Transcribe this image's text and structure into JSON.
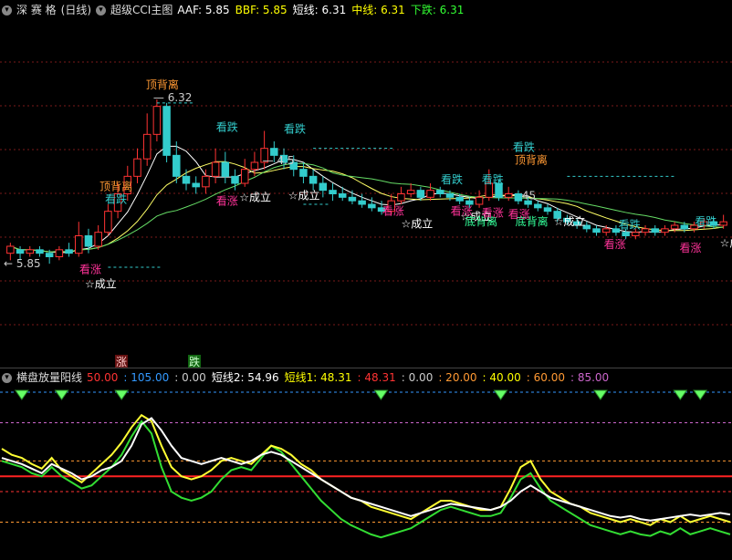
{
  "top_panel": {
    "stock_name": "深 赛 格",
    "period": "(日线)",
    "indicator": "超级CCI主图",
    "legends": [
      {
        "label": "AAF:",
        "value": "5.85",
        "color": "#ffffff"
      },
      {
        "label": "BBF:",
        "value": "5.85",
        "color": "#ffff00"
      },
      {
        "label": "短线:",
        "value": "6.31",
        "color": "#ffffff"
      },
      {
        "label": "中线:",
        "value": "6.31",
        "color": "#ffff00"
      },
      {
        "label": "下跌:",
        "value": "6.31",
        "color": "#33ff33"
      }
    ]
  },
  "bottom_panel": {
    "indicator": "横盘放量阳线",
    "legends": [
      {
        "value": "50.00",
        "color": "#ff3333"
      },
      {
        "value": ": 105.00",
        "color": "#3399ff"
      },
      {
        "value": ": 0.00",
        "color": "#cccccc"
      },
      {
        "value": "短线2: 54.96",
        "color": "#ffffff"
      },
      {
        "value": "短线1: 48.31",
        "color": "#ffff00"
      },
      {
        "value": ": 48.31",
        "color": "#ff3333"
      },
      {
        "value": ": 0.00",
        "color": "#cccccc"
      },
      {
        "value": ": 20.00",
        "color": "#ff9933"
      },
      {
        "value": ": 40.00",
        "color": "#ffff00"
      },
      {
        "value": ": 60.00",
        "color": "#ff9933"
      },
      {
        "value": ": 85.00",
        "color": "#cc66cc"
      }
    ]
  },
  "annotations": {
    "high_price": "6.32",
    "low_price": "5.85",
    "level_45": "4.5",
    "level_45b": "45",
    "top_divergence": "顶背离",
    "bottom_divergence": "底背离",
    "look_down": "看跌",
    "look_up": "看涨",
    "established": "☆成立",
    "zhang_tag": "涨",
    "die_tag": "跌"
  },
  "chart_data": {
    "type": "candlestick",
    "series_count": 74,
    "price_range": [
      5.6,
      6.5
    ],
    "candles": [
      [
        5.88,
        5.9,
        5.86,
        5.91,
        "r"
      ],
      [
        5.89,
        5.88,
        5.86,
        5.9,
        "g"
      ],
      [
        5.88,
        5.89,
        5.87,
        5.9,
        "r"
      ],
      [
        5.89,
        5.88,
        5.87,
        5.9,
        "g"
      ],
      [
        5.88,
        5.87,
        5.85,
        5.89,
        "g"
      ],
      [
        5.87,
        5.89,
        5.86,
        5.9,
        "r"
      ],
      [
        5.89,
        5.88,
        5.87,
        5.91,
        "g"
      ],
      [
        5.88,
        5.93,
        5.87,
        5.97,
        "r"
      ],
      [
        5.93,
        5.9,
        5.88,
        5.95,
        "g"
      ],
      [
        5.9,
        5.94,
        5.89,
        5.96,
        "r"
      ],
      [
        5.94,
        6.0,
        5.93,
        6.02,
        "r"
      ],
      [
        6.0,
        6.05,
        5.98,
        6.08,
        "r"
      ],
      [
        6.05,
        6.1,
        6.03,
        6.13,
        "r"
      ],
      [
        6.1,
        6.15,
        6.08,
        6.18,
        "r"
      ],
      [
        6.15,
        6.22,
        6.13,
        6.28,
        "r"
      ],
      [
        6.22,
        6.3,
        6.2,
        6.32,
        "r"
      ],
      [
        6.3,
        6.16,
        6.14,
        6.31,
        "g"
      ],
      [
        6.16,
        6.1,
        6.08,
        6.2,
        "g"
      ],
      [
        6.1,
        6.08,
        6.06,
        6.12,
        "g"
      ],
      [
        6.08,
        6.07,
        6.05,
        6.1,
        "g"
      ],
      [
        6.07,
        6.1,
        6.05,
        6.12,
        "r"
      ],
      [
        6.1,
        6.14,
        6.08,
        6.18,
        "r"
      ],
      [
        6.14,
        6.1,
        6.08,
        6.17,
        "g"
      ],
      [
        6.1,
        6.08,
        6.06,
        6.12,
        "g"
      ],
      [
        6.08,
        6.12,
        6.07,
        6.15,
        "r"
      ],
      [
        6.12,
        6.14,
        6.1,
        6.17,
        "r"
      ],
      [
        6.14,
        6.18,
        6.12,
        6.23,
        "r"
      ],
      [
        6.18,
        6.16,
        6.14,
        6.2,
        "g"
      ],
      [
        6.16,
        6.14,
        6.12,
        6.18,
        "g"
      ],
      [
        6.14,
        6.12,
        6.1,
        6.16,
        "g"
      ],
      [
        6.12,
        6.1,
        6.08,
        6.14,
        "g"
      ],
      [
        6.1,
        6.08,
        6.06,
        6.12,
        "g"
      ],
      [
        6.08,
        6.06,
        6.04,
        6.1,
        "g"
      ],
      [
        6.06,
        6.05,
        6.03,
        6.08,
        "g"
      ],
      [
        6.05,
        6.04,
        6.03,
        6.07,
        "g"
      ],
      [
        6.04,
        6.03,
        6.02,
        6.06,
        "g"
      ],
      [
        6.03,
        6.02,
        6.01,
        6.05,
        "g"
      ],
      [
        6.02,
        6.01,
        6.0,
        6.04,
        "g"
      ],
      [
        6.01,
        6.0,
        5.99,
        6.03,
        "g"
      ],
      [
        6.0,
        6.03,
        5.99,
        6.05,
        "r"
      ],
      [
        6.03,
        6.05,
        6.02,
        6.07,
        "r"
      ],
      [
        6.05,
        6.06,
        6.04,
        6.08,
        "r"
      ],
      [
        6.06,
        6.04,
        6.03,
        6.07,
        "g"
      ],
      [
        6.04,
        6.06,
        6.03,
        6.08,
        "r"
      ],
      [
        6.06,
        6.05,
        6.04,
        6.07,
        "g"
      ],
      [
        6.05,
        6.04,
        6.03,
        6.06,
        "g"
      ],
      [
        6.04,
        6.03,
        6.02,
        6.05,
        "g"
      ],
      [
        6.03,
        6.02,
        6.01,
        6.04,
        "g"
      ],
      [
        6.02,
        6.04,
        6.01,
        6.06,
        "r"
      ],
      [
        6.04,
        6.08,
        6.03,
        6.12,
        "r"
      ],
      [
        6.08,
        6.04,
        6.03,
        6.09,
        "g"
      ],
      [
        6.04,
        6.05,
        6.03,
        6.07,
        "r"
      ],
      [
        6.05,
        6.03,
        6.02,
        6.06,
        "g"
      ],
      [
        6.03,
        6.02,
        6.01,
        6.04,
        "g"
      ],
      [
        6.02,
        6.01,
        6.0,
        6.03,
        "g"
      ],
      [
        6.01,
        6.0,
        5.99,
        6.02,
        "g"
      ],
      [
        6.0,
        5.98,
        5.97,
        6.01,
        "g"
      ],
      [
        5.98,
        5.97,
        5.96,
        5.99,
        "g"
      ],
      [
        5.97,
        5.96,
        5.95,
        5.98,
        "g"
      ],
      [
        5.96,
        5.95,
        5.94,
        5.97,
        "g"
      ],
      [
        5.95,
        5.94,
        5.93,
        5.96,
        "g"
      ],
      [
        5.94,
        5.95,
        5.93,
        5.96,
        "r"
      ],
      [
        5.95,
        5.94,
        5.93,
        5.96,
        "g"
      ],
      [
        5.94,
        5.93,
        5.92,
        5.95,
        "g"
      ],
      [
        5.93,
        5.94,
        5.92,
        5.95,
        "r"
      ],
      [
        5.94,
        5.95,
        5.93,
        5.96,
        "r"
      ],
      [
        5.95,
        5.94,
        5.93,
        5.96,
        "g"
      ],
      [
        5.94,
        5.95,
        5.93,
        5.96,
        "r"
      ],
      [
        5.95,
        5.96,
        5.94,
        5.97,
        "r"
      ],
      [
        5.96,
        5.95,
        5.94,
        5.97,
        "g"
      ],
      [
        5.95,
        5.96,
        5.94,
        5.97,
        "r"
      ],
      [
        5.96,
        5.97,
        5.95,
        5.98,
        "r"
      ],
      [
        5.97,
        5.96,
        5.95,
        5.98,
        "g"
      ],
      [
        5.96,
        5.97,
        5.95,
        5.99,
        "r"
      ]
    ],
    "osc_white": [
      62,
      60,
      58,
      55,
      52,
      58,
      55,
      52,
      48,
      50,
      54,
      56,
      60,
      70,
      84,
      88,
      80,
      70,
      62,
      60,
      58,
      60,
      62,
      60,
      58,
      60,
      64,
      66,
      64,
      60,
      56,
      52,
      48,
      44,
      40,
      36,
      34,
      32,
      30,
      28,
      26,
      24,
      26,
      28,
      30,
      32,
      31,
      30,
      29,
      28,
      30,
      34,
      40,
      44,
      40,
      36,
      34,
      32,
      30,
      28,
      26,
      24,
      23,
      24,
      22,
      21,
      22,
      23,
      24,
      25,
      24,
      25,
      26,
      25
    ],
    "osc_yellow": [
      68,
      64,
      62,
      58,
      55,
      62,
      54,
      50,
      46,
      52,
      58,
      64,
      72,
      82,
      90,
      86,
      70,
      56,
      50,
      48,
      50,
      54,
      60,
      62,
      60,
      58,
      64,
      70,
      68,
      64,
      58,
      54,
      48,
      44,
      40,
      36,
      34,
      30,
      28,
      26,
      24,
      22,
      26,
      30,
      34,
      34,
      32,
      30,
      28,
      28,
      30,
      42,
      56,
      60,
      48,
      40,
      36,
      32,
      30,
      26,
      24,
      22,
      20,
      22,
      20,
      18,
      22,
      20,
      24,
      20,
      22,
      24,
      22,
      20
    ],
    "osc_green": [
      60,
      58,
      56,
      52,
      50,
      56,
      50,
      46,
      42,
      44,
      50,
      56,
      64,
      76,
      86,
      78,
      56,
      40,
      36,
      34,
      36,
      40,
      48,
      54,
      56,
      54,
      62,
      70,
      66,
      58,
      50,
      42,
      34,
      28,
      22,
      18,
      15,
      12,
      10,
      12,
      14,
      16,
      20,
      24,
      28,
      30,
      28,
      26,
      24,
      24,
      26,
      36,
      48,
      52,
      42,
      34,
      30,
      26,
      22,
      18,
      16,
      14,
      12,
      14,
      12,
      11,
      14,
      12,
      16,
      12,
      14,
      16,
      14,
      12
    ],
    "osc_levels": [
      20,
      40,
      50,
      60,
      85,
      105
    ],
    "diamonds_at": [
      2,
      6,
      12,
      38,
      50,
      60,
      68,
      70
    ]
  }
}
